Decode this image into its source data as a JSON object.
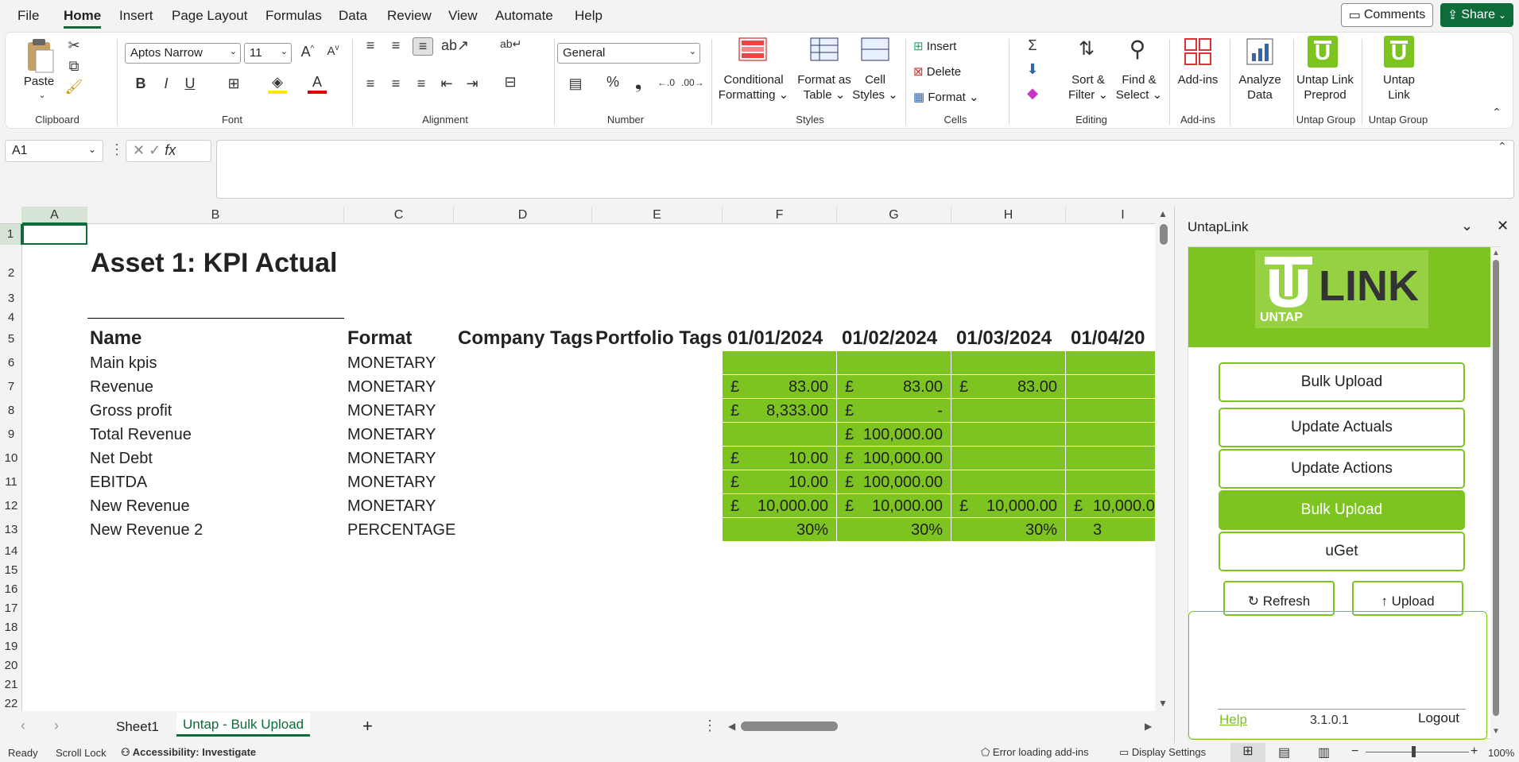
{
  "menubar": {
    "items": [
      "File",
      "Home",
      "Insert",
      "Page Layout",
      "Formulas",
      "Data",
      "Review",
      "View",
      "Automate",
      "Help"
    ],
    "comments": "Comments",
    "share": "Share"
  },
  "ribbon": {
    "paste": "Paste",
    "font_name": "Aptos Narrow",
    "font_size": "11",
    "number_format": "General",
    "groups": {
      "clipboard": "Clipboard",
      "font": "Font",
      "alignment": "Alignment",
      "number": "Number",
      "styles": "Styles",
      "cells": "Cells",
      "editing": "Editing",
      "addins": "Add-ins",
      "untap1": "Untap Group",
      "untap2": "Untap Group"
    },
    "conditional": [
      "Conditional",
      "Formatting ⌄"
    ],
    "format_table": [
      "Format as",
      "Table ⌄"
    ],
    "cell_styles": [
      "Cell",
      "Styles ⌄"
    ],
    "insert": "Insert",
    "delete": "Delete",
    "format": "Format ⌄",
    "sort": [
      "Sort &",
      "Filter ⌄"
    ],
    "find": [
      "Find &",
      "Select ⌄"
    ],
    "addins": "Add-ins",
    "analyze": [
      "Analyze",
      "Data"
    ],
    "untap_preprod": [
      "Untap Link",
      "Preprod"
    ],
    "untap_link": [
      "Untap",
      "Link"
    ],
    "icons": {
      "paste": "clipboard-icon",
      "bold": "B",
      "italic": "I",
      "underline": "U",
      "percent": "%",
      "comma": "❟",
      "fx": "fx"
    }
  },
  "formula": {
    "namebox": "A1",
    "content": ""
  },
  "sheet": {
    "col_headers": [
      "A",
      "B",
      "C",
      "D",
      "E",
      "F",
      "G",
      "H",
      "I"
    ],
    "rows": [
      "1",
      "2",
      "3",
      "4",
      "5",
      "6",
      "7",
      "8",
      "9",
      "10",
      "11",
      "12",
      "13",
      "14",
      "15",
      "16",
      "17",
      "18",
      "19",
      "20",
      "21",
      "22"
    ],
    "title": "Asset 1: KPI Actual",
    "headers": [
      "Name",
      "Format",
      "Company Tags",
      "Portfolio Tags",
      "01/01/2024",
      "01/02/2024",
      "01/03/2024",
      "01/04/20"
    ],
    "data": [
      {
        "name": "Main kpis",
        "format": "MONETARY",
        "f": [
          "",
          ""
        ],
        "g": [
          "",
          ""
        ],
        "h": [
          "",
          ""
        ],
        "i": [
          "",
          ""
        ]
      },
      {
        "name": "Revenue",
        "format": "MONETARY",
        "f": [
          "£",
          "83.00"
        ],
        "g": [
          "£",
          "83.00"
        ],
        "h": [
          "£",
          "83.00"
        ],
        "i": [
          "",
          ""
        ]
      },
      {
        "name": "Gross profit",
        "format": "MONETARY",
        "f": [
          "£",
          "8,333.00"
        ],
        "g": [
          "£",
          "-"
        ],
        "h": [
          "",
          ""
        ],
        "i": [
          "",
          ""
        ]
      },
      {
        "name": "Total Revenue",
        "format": "MONETARY",
        "f": [
          "",
          ""
        ],
        "g": [
          "£",
          "100,000.00"
        ],
        "h": [
          "",
          ""
        ],
        "i": [
          "",
          ""
        ]
      },
      {
        "name": "Net Debt",
        "format": "MONETARY",
        "f": [
          "£",
          "10.00"
        ],
        "g": [
          "£",
          "100,000.00"
        ],
        "h": [
          "",
          ""
        ],
        "i": [
          "",
          ""
        ]
      },
      {
        "name": "EBITDA",
        "format": "MONETARY",
        "f": [
          "£",
          "10.00"
        ],
        "g": [
          "£",
          "100,000.00"
        ],
        "h": [
          "",
          ""
        ],
        "i": [
          "",
          ""
        ]
      },
      {
        "name": "New Revenue",
        "format": "MONETARY",
        "f": [
          "£",
          "10,000.00"
        ],
        "g": [
          "£",
          "10,000.00"
        ],
        "h": [
          "£",
          "10,000.00"
        ],
        "i": [
          "£",
          "10,000.0"
        ]
      },
      {
        "name": "New Revenue 2",
        "format": "PERCENTAGE",
        "f": [
          "",
          "30%"
        ],
        "g": [
          "",
          "30%"
        ],
        "h": [
          "",
          "30%"
        ],
        "i": [
          "",
          "3"
        ]
      }
    ],
    "tabs": [
      "Sheet1",
      "Untap - Bulk Upload"
    ],
    "active_tab": "Untap - Bulk Upload"
  },
  "status": {
    "ready": "Ready",
    "scroll_lock": "Scroll Lock",
    "accessibility": "Accessibility: Investigate",
    "addins_error": "Error loading add-ins",
    "display": "Display Settings",
    "zoom": "100%"
  },
  "pane": {
    "title": "UntapLink",
    "logo_text": "LINK",
    "logo_sub": "UNTAP",
    "buttons": [
      "Bulk Upload",
      "Update Actuals",
      "Update Actions",
      "Bulk Upload",
      "uGet"
    ],
    "refresh": "Refresh",
    "upload": "Upload",
    "help": "Help",
    "version": "3.1.0.1",
    "logout": "Logout",
    "colors": {
      "green": "#7dc420",
      "dark": "#4a7f10"
    }
  }
}
